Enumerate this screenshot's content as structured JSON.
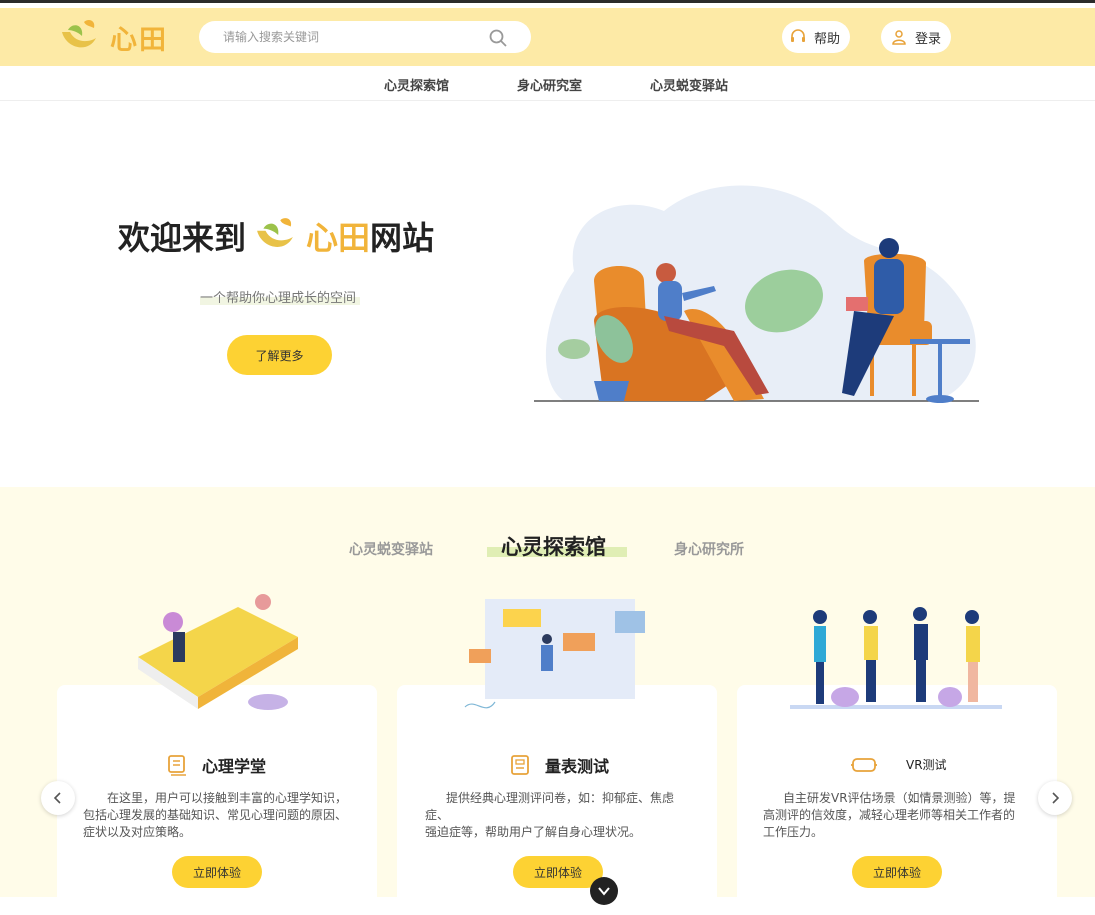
{
  "header": {
    "logo_text": "心田",
    "search_placeholder": "请输入搜索关键词",
    "help_label": "帮助",
    "login_label": "登录"
  },
  "nav": {
    "items": [
      "心灵探索馆",
      "身心研究室",
      "心灵蜕变驿站"
    ]
  },
  "hero": {
    "title_prefix": "欢迎来到",
    "title_brand": "心田",
    "title_suffix": "网站",
    "subtitle": "一个帮助你心理成长的空间",
    "cta_label": "了解更多"
  },
  "section": {
    "tabs": [
      "心灵蜕变驿站",
      "心灵探索馆",
      "身心研究所"
    ],
    "active_tab": "心灵探索馆",
    "cards": [
      {
        "icon": "book-icon",
        "title": "心理学堂",
        "desc": "在这里，用户可以接触到丰富的心理学知识，包括心理发展的基础知识、常见心理问题的原因、症状以及对应策略。",
        "button": "立即体验"
      },
      {
        "icon": "scale-icon",
        "title": "量表测试",
        "desc_line1": "提供经典心理测评问卷，如：抑郁症、焦虑症、",
        "desc_line2": "强迫症等，帮助用户了解自身心理状况。",
        "button": "立即体验"
      },
      {
        "icon": "vr-icon",
        "title": "VR测试",
        "desc": "自主研发VR评估场景（如情景测验）等，提高测评的信效度，减轻心理老师等相关工作者的工作压力。",
        "button": "立即体验"
      }
    ]
  },
  "colors": {
    "header_bg": "#fdeaa6",
    "accent": "#fdd233",
    "brand": "#f1b43a",
    "section_bg": "#fffce9"
  }
}
